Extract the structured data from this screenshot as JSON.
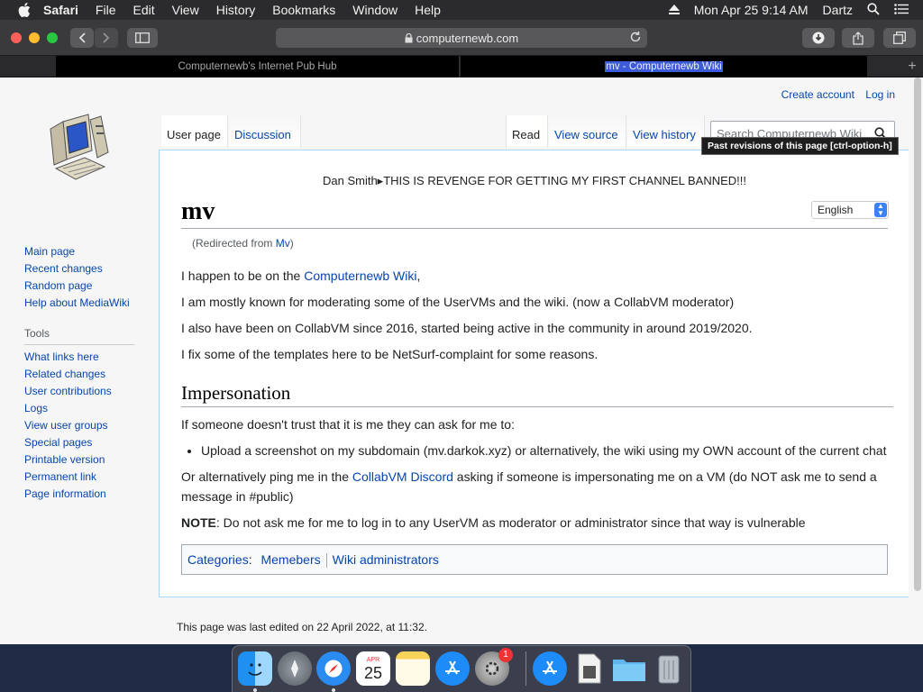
{
  "menubar": {
    "app_name": "Safari",
    "items": [
      "File",
      "Edit",
      "View",
      "History",
      "Bookmarks",
      "Window",
      "Help"
    ],
    "clock": "Mon Apr 25  9:14 AM",
    "user": "Dartz"
  },
  "toolbar": {
    "url": "computernewb.com"
  },
  "tabs": [
    {
      "title": "Computernewb's Internet Pub Hub",
      "active": false
    },
    {
      "title": "mv - Computernewb Wiki",
      "active": true
    }
  ],
  "wiki": {
    "personal": {
      "create_account": "Create account",
      "log_in": "Log in"
    },
    "tabs_left": [
      "User page",
      "Discussion"
    ],
    "tabs_right": [
      "Read",
      "View source",
      "View history"
    ],
    "search_placeholder": "Search Computernewb Wiki",
    "tooltip": "Past revisions of this page [ctrl-option-h]",
    "sidebar_nav": [
      "Main page",
      "Recent changes",
      "Random page",
      "Help about MediaWiki"
    ],
    "tools_heading": "Tools",
    "sidebar_tools": [
      "What links here",
      "Related changes",
      "User contributions",
      "Logs",
      "View user groups",
      "Special pages",
      "Printable version",
      "Permanent link",
      "Page information"
    ],
    "sitenotice": "Dan Smith▸THIS IS REVENGE FOR GETTING MY FIRST CHANNEL BANNED!!!",
    "language": "English",
    "page_title": "mv",
    "redirect": {
      "prefix": "(Redirected from ",
      "link": "Mv",
      "suffix": ")"
    },
    "p1": {
      "text": "I happen to be on the ",
      "link": "Computernewb Wiki",
      "after": ","
    },
    "p2": "I am mostly known for moderating some of the UserVMs and the wiki. (now a CollabVM moderator)",
    "p3": "I also have been on CollabVM since 2016, started being active in the community in around 2019/2020.",
    "p4": "I fix some of the templates here to be NetSurf-complaint for some reasons.",
    "h2": "Impersonation",
    "p5": "If someone doesn't trust that it is me they can ask for me to:",
    "li1": "Upload a screenshot on my subdomain (mv.darkok.xyz) or alternatively, the wiki using my OWN account of the current chat",
    "p6": {
      "before": "Or alternatively ping me in the ",
      "link": "CollabVM Discord",
      "after": " asking if someone is impersonating me on a VM (do NOT ask me to send a message in #public)"
    },
    "note": {
      "label": "NOTE",
      "text": ": Do not ask me for me to log in to any UserVM as moderator or administrator since that way is vulnerable"
    },
    "categories": {
      "label": "Categories",
      "items": [
        "Memebers",
        "Wiki administrators"
      ]
    },
    "footer": "This page was last edited on 22 April 2022, at 11:32."
  },
  "dock": {
    "calendar_month": "APR",
    "calendar_day": "25",
    "prefs_badge": "1",
    "icons": [
      "finder-icon",
      "launchpad-icon",
      "safari-icon",
      "calendar-icon",
      "notes-icon",
      "app-store-icon",
      "system-preferences-icon",
      "apps-folder-icon",
      "document-icon",
      "downloads-folder-icon",
      "trash-icon"
    ]
  },
  "colors": {
    "link": "#0645ad",
    "menubar": "#2b2b2d",
    "toolbar": "#3a3a3c"
  }
}
